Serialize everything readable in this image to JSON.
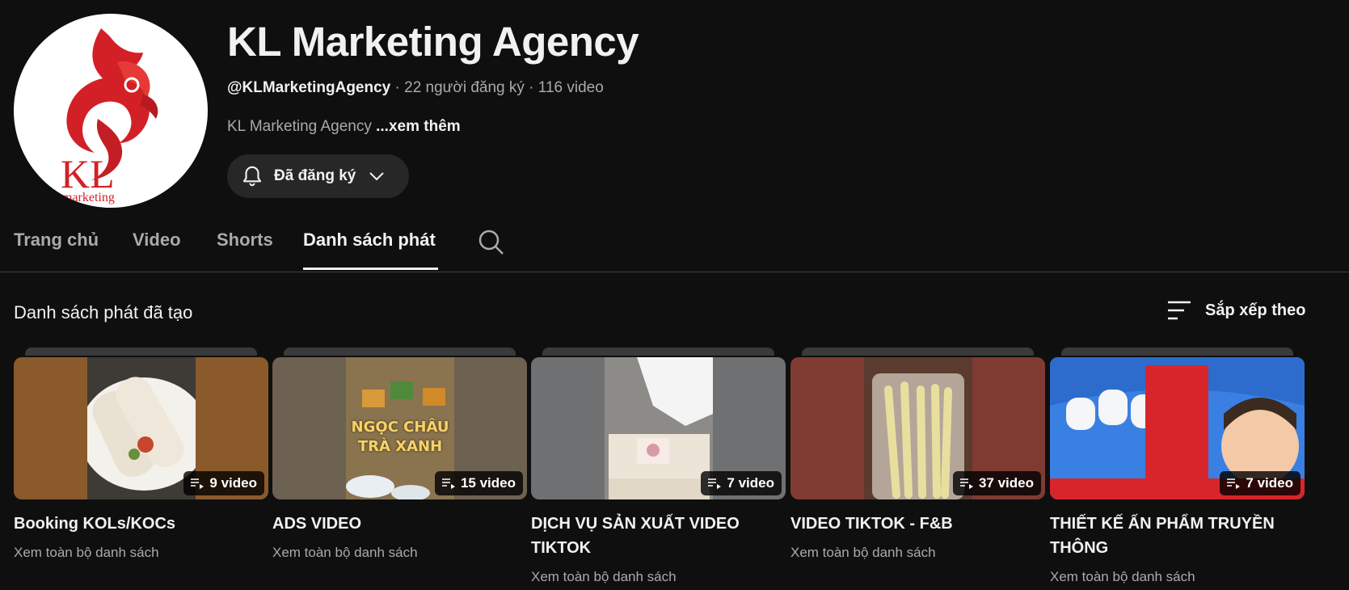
{
  "channel": {
    "title": "KL Marketing Agency",
    "handle": "@KLMarketingAgency",
    "subscribers": "22 người đăng ký",
    "video_count": "116 video",
    "separator": " · ",
    "description": "KL Marketing Agency ",
    "more_label": "...xem thêm",
    "subscribe_label": "Đã đăng ký",
    "avatar_logo": {
      "text": "KL",
      "subtext": "marketing",
      "color": "#d32027"
    }
  },
  "tabs": [
    {
      "label": "Trang chủ"
    },
    {
      "label": "Video"
    },
    {
      "label": "Shorts"
    },
    {
      "label": "Danh sách phát",
      "active": true
    }
  ],
  "section": {
    "title": "Danh sách phát đã tạo",
    "sort_label": "Sắp xếp theo"
  },
  "playlists": [
    {
      "title": "Booking KOLs/KOCs",
      "count": "9 video",
      "link": "Xem toàn bộ danh sách",
      "side_color": "#8b5a2b"
    },
    {
      "title": "ADS VIDEO",
      "count": "15 video",
      "link": "Xem toàn bộ danh sách",
      "side_color": "#6d6152",
      "overlay": "NGỌC CHÂU\nTRÀ XANH"
    },
    {
      "title": "DỊCH VỤ SẢN XUẤT VIDEO TIKTOK",
      "count": "7 video",
      "link": "Xem toàn bộ danh sách",
      "side_color": "#6f7072"
    },
    {
      "title": "VIDEO TIKTOK - F&B",
      "count": "37 video",
      "link": "Xem toàn bộ danh sách",
      "side_color": "#7f3b32"
    },
    {
      "title": "THIẾT KẾ ẤN PHẨM TRUYỀN THÔNG",
      "count": "7 video",
      "link": "Xem toàn bộ danh sách",
      "side_color": "#2f6fd6"
    }
  ],
  "icons": {
    "bell": "bell-icon",
    "chevron": "chevron-down-icon",
    "search": "search-icon",
    "sort": "sort-icon",
    "playlist": "playlist-icon"
  }
}
